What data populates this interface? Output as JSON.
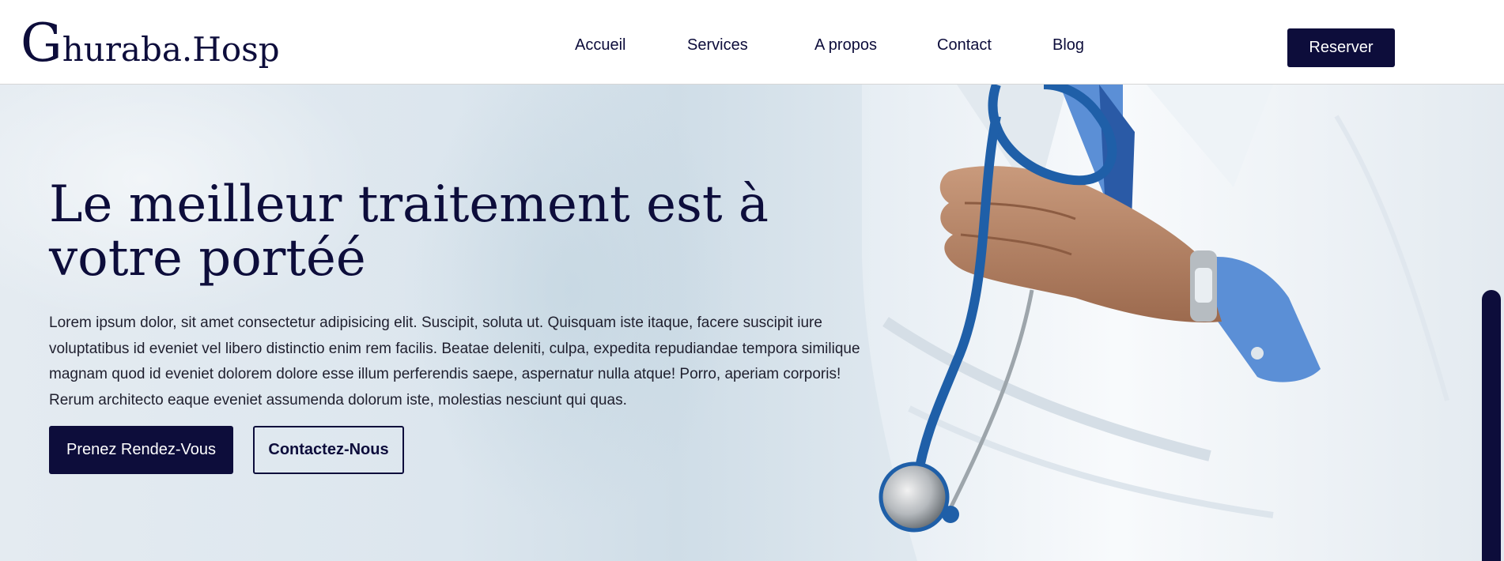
{
  "logo": {
    "initial": "G",
    "rest": "huraba.Hosp"
  },
  "nav": {
    "items": [
      {
        "label": "Accueil"
      },
      {
        "label": "Services"
      },
      {
        "label": "A propos"
      },
      {
        "label": "Contact"
      },
      {
        "label": "Blog"
      }
    ],
    "reserve_label": "Reserver"
  },
  "hero": {
    "title": "Le meilleur traitement est à votre portéé",
    "text": "Lorem ipsum dolor, sit amet consectetur adipisicing elit. Suscipit, soluta ut. Quisquam iste itaque, facere suscipit iure voluptatibus id eveniet vel libero distinctio enim rem facilis. Beatae deleniti, culpa, expedita repudiandae tempora similique magnam quod id eveniet dolorem dolore esse illum perferendis saepe, aspernatur nulla atque! Porro, aperiam corporis! Rerum architecto eaque eveniet assumenda dolorum iste, molestias nesciunt qui quas.",
    "primary_button": "Prenez Rendez-Vous",
    "secondary_button": "Contactez-Nous",
    "image_subject": "doctor-with-stethoscope"
  },
  "colors": {
    "brand": "#0d0d3b",
    "hero_background": "#dce6ee",
    "coat": "#f4f7fa",
    "shirt": "#5b8fd6",
    "stethoscope": "#1f5fa8",
    "skin": "#b98a6e"
  }
}
